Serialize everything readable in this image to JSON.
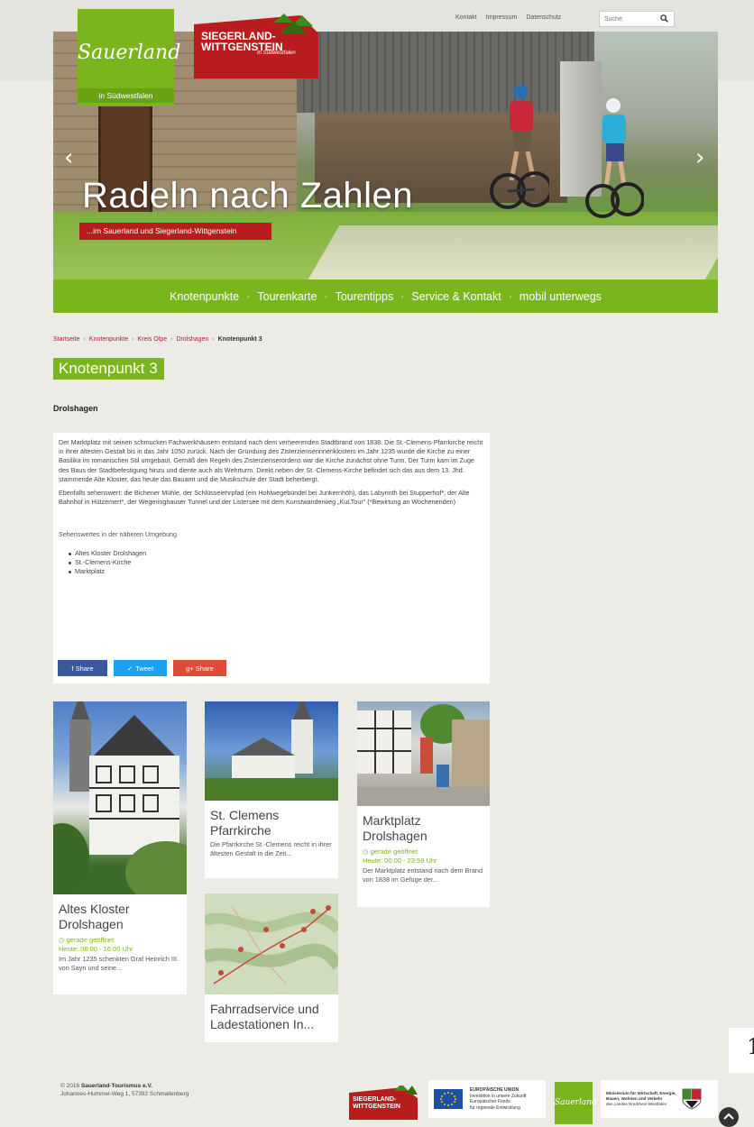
{
  "header": {
    "links": [
      "Kontakt",
      "Impressum",
      "Datenschutz"
    ],
    "search_placeholder": "Suche",
    "logo_sauerland": "Sauerland",
    "logo_sauerland_tag": "in Südwestfalen",
    "logo_sw_line1": "SIEGERLAND-",
    "logo_sw_line2": "WITTGENSTEIN",
    "logo_sw_small": "In Südwestfalen"
  },
  "hero": {
    "title": "Radeln nach Zahlen",
    "subtitle": "...im Sauerland und Siegerland-Wittgenstein",
    "prev": "‹",
    "next": "›"
  },
  "nav": [
    "Knotenpunkte",
    "Tourenkarte",
    "Tourentipps",
    "Service & Kontakt",
    "mobil unterwegs"
  ],
  "breadcrumb": {
    "items": [
      "Startseite",
      "Knotenpunkte",
      "Kreis Olpe",
      "Drolshagen"
    ],
    "current": "Knotenpunkt 3"
  },
  "page_title": "Knotenpunkt 3",
  "subtitle": "Drolshagen",
  "article": {
    "p1": "Der Marktplatz mit seinen schmucken Fachwerkhäusern entstand nach dem verheerenden Stadtbrand von 1838. Die St.-Clemens-Pfarrkirche reicht in ihrer ältesten Gestalt bis in das Jahr 1050 zurück. Nach der Gründung des Zisterzienserinnenklosters im Jahr 1235 wurde die Kirche zu einer Basilika im romanischen Stil umgebaut. Gemäß den Regeln des Zisterzienserordens war die Kirche zunächst ohne Turm. Der Turm kam im Zuge des Baus der Stadtbefestigung hinzu und diente auch als Wehrturm. Direkt neben der St.-Clemens-Kirche befindet sich das aus dem 13. Jhd. stammende Alte Kloster, das heute das Bauamt und die Musikschule der Stadt beherbergt.",
    "p2": "Ebenfalls sehenswert: die Bichener Mühle, der Schlüsselehrpfad (ein Hohlwegebündel bei Junkernhöh), das Labyrinth bei Stupperhof*, der Alte Bahnhof in Hützemert*, der Wegeringhauser Tunnel und der Listersee mit dem Kunstwanderweg „KuLTour\" (*Bewirtung an Wochenenden)",
    "near_heading": "Sehenswertes in der näheren Umgebung",
    "near_items": [
      "Altes Kloster Drolshagen",
      "St.-Clemens-Kirche",
      "Marktplatz"
    ]
  },
  "share": {
    "facebook": "f Share",
    "twitter": "Tweet",
    "gplus": "g+ Share"
  },
  "cards": [
    {
      "title": "Altes Kloster Drolshagen",
      "status": "gerade geöffnet",
      "hours": "Heute: 08:00 - 16:00 Uhr",
      "desc": "Im Jahr 1235 schenkten Graf Heinrich III. von Sayn und seine..."
    },
    {
      "title": "St. Clemens Pfarrkirche",
      "desc": "Die Pfarrkirche St.-Clemens reicht in ihrer ältesten Gestalt in die Zeit..."
    },
    {
      "title": "Marktplatz Drolshagen",
      "status": "gerade geöffnet",
      "hours": "Heute: 00:00 - 23:59 Uhr",
      "desc": "Der Marktplatz entstand nach dem Brand von 1838 im Gefüge der..."
    },
    {
      "title": "Fahrradservice und Ladestationen In..."
    }
  ],
  "footer": {
    "copyright_prefix": "© 2016 ",
    "org": "Sauerland-Tourismus e.V.",
    "address": "Johannes-Hummel-Weg 1, 57392 Schmallenberg",
    "eu_text1": "EUROPÄISCHE UNION",
    "eu_text2": "Investition in unsere Zukunft",
    "eu_text3": "Europäischer Fonds",
    "eu_text4": "für regionale Entwicklung",
    "mw_text1": "Ministerium für Wirtschaft, Energie,",
    "mw_text2": "Bauen, Wohnen und Verkehr",
    "mw_text3": "des Landes Nordrhein-Westfalen",
    "sw_logo_line1": "SIEGERLAND-",
    "sw_logo_line2": "WITTGENSTEIN"
  },
  "page_number": "1",
  "colors": {
    "green": "#7ab51d",
    "red": "#b81c1c",
    "facebook": "#3b5998",
    "twitter": "#1da1f2",
    "gplus": "#dd4b39"
  }
}
